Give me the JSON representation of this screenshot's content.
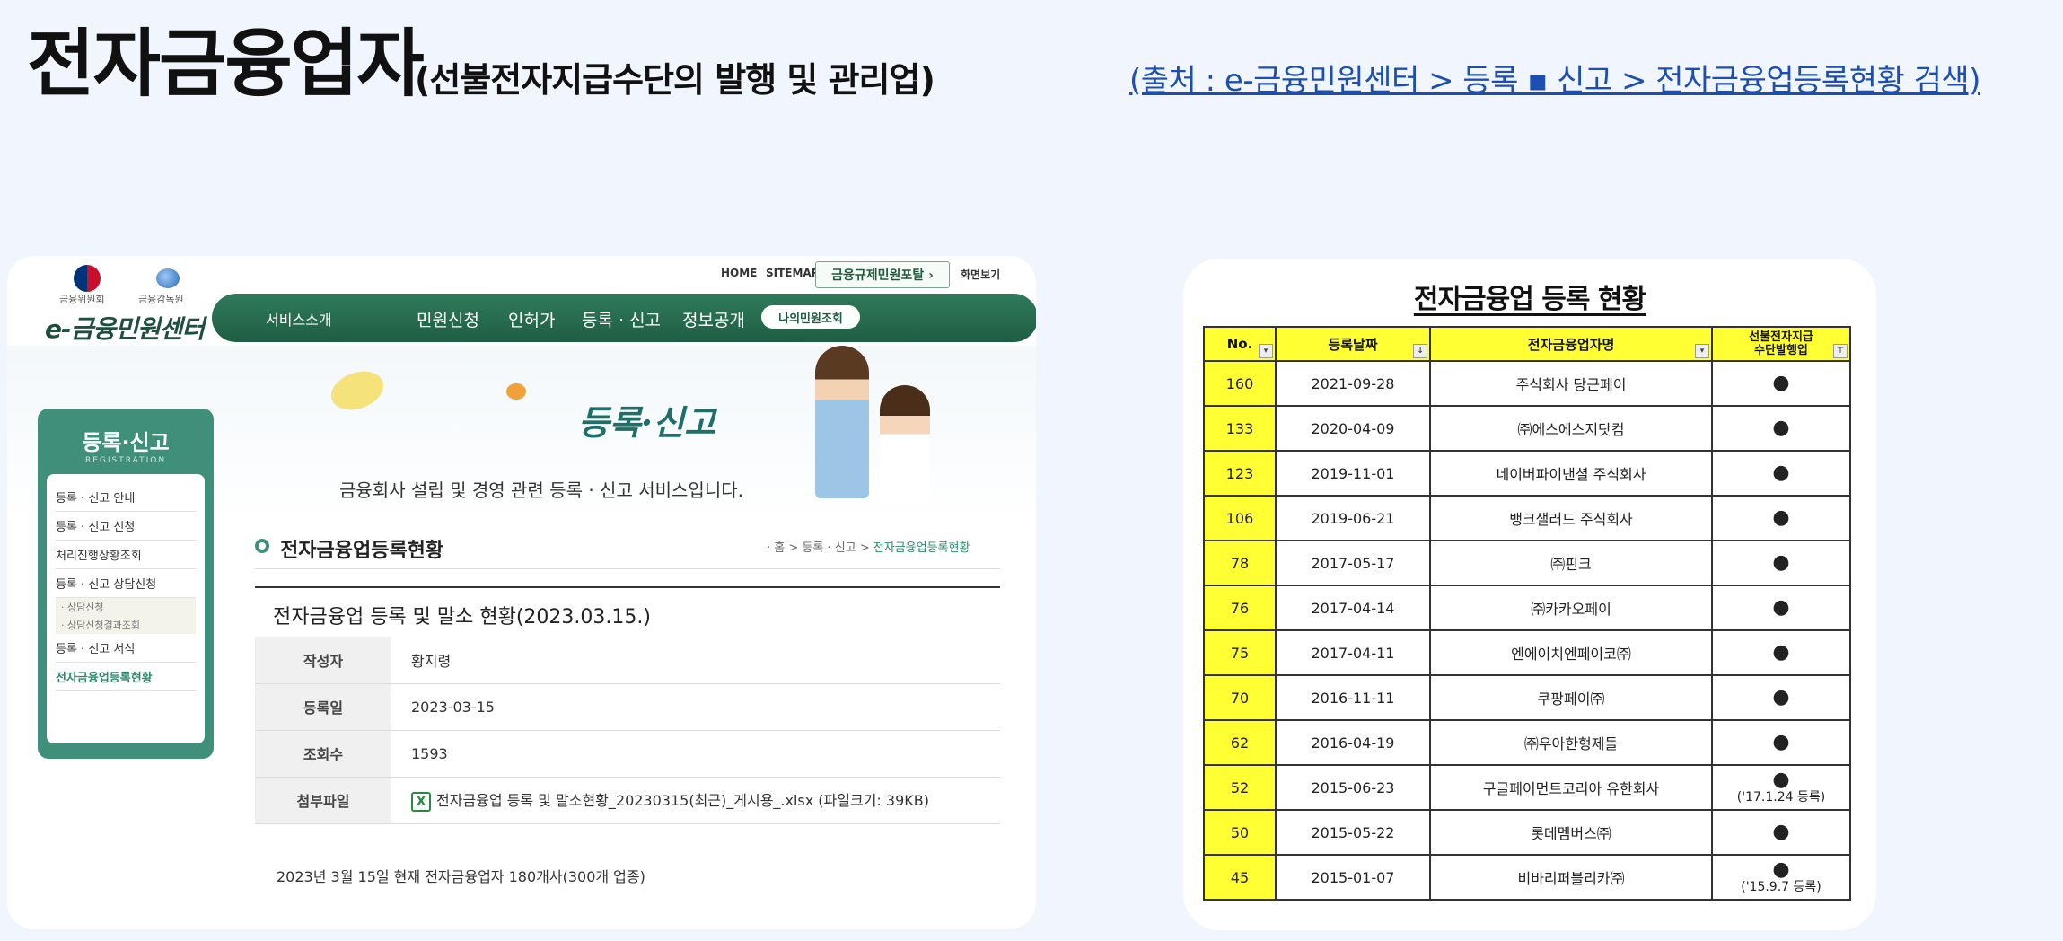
{
  "header": {
    "title_main": "전자금융업자",
    "title_sub": "(선불전자지급수단의 발행 및 관리업)",
    "source_link": "(출처 : e-금융민원센터 > 등록 ▪ 신고 > 전자금융업등록현황 검색)"
  },
  "left_screenshot": {
    "top_links": [
      "HOME",
      "SITEMAP"
    ],
    "portal_button": "금융규제민원포탈 ›",
    "view_label": "화면보기",
    "org_1": "금융위원회",
    "org_2": "금융감독원",
    "site_name": "e-금융민원센터",
    "nav": {
      "service_intro": "서비스소개",
      "items": [
        "민원신청",
        "인허가",
        "등록 · 신고",
        "정보공개"
      ],
      "my_button": "나의민원조회"
    },
    "banner_title": "등록·신고",
    "banner_desc": "금융회사 설립 및 경영 관련 등록 · 신고 서비스입니다.",
    "side_menu": {
      "title": "등록·신고",
      "subtitle": "REGISTRATION",
      "items": [
        "등록 · 신고 안내",
        "등록 · 신고 신청",
        "처리진행상황조회",
        "등록 · 신고 상담신청"
      ],
      "sub_items": [
        "· 상담신청",
        "· 상담신청결과조회"
      ],
      "items_after": [
        "등록 · 신고 서식",
        "전자금융업등록현황"
      ]
    },
    "section_title": "전자금융업등록현황",
    "breadcrumb": {
      "prefix": "· 홈 > 등록 · 신고 > ",
      "current": "전자금융업등록현황"
    },
    "post_title": "전자금융업 등록 및 말소 현황(2023.03.15.)",
    "post_rows": [
      {
        "key": "작성자",
        "value": "황지령"
      },
      {
        "key": "등록일",
        "value": "2023-03-15"
      },
      {
        "key": "조회수",
        "value": "1593"
      },
      {
        "key": "첨부파일",
        "value": "전자금융업 등록 및 말소현황_20230315(최근)_게시용_.xlsx (파일크기: 39KB)"
      }
    ],
    "xls_icon": "X",
    "footer_note": "2023년 3월 15일 현재 전자금융업자 180개사(300개 업종)"
  },
  "right_table": {
    "title": "전자금융업 등록 현황",
    "headers": [
      "No.",
      "등록날짜",
      "전자금융업자명",
      "선불전자지급\n수단발행업"
    ],
    "rows": [
      {
        "no": "160",
        "date": "2021-09-28",
        "name": "주식회사 당근페이",
        "mark": "●",
        "note": ""
      },
      {
        "no": "133",
        "date": "2020-04-09",
        "name": "㈜에스에스지닷컴",
        "mark": "●",
        "note": ""
      },
      {
        "no": "123",
        "date": "2019-11-01",
        "name": "네이버파이낸셜 주식회사",
        "mark": "●",
        "note": ""
      },
      {
        "no": "106",
        "date": "2019-06-21",
        "name": "뱅크샐러드 주식회사",
        "mark": "●",
        "note": ""
      },
      {
        "no": "78",
        "date": "2017-05-17",
        "name": "㈜핀크",
        "mark": "●",
        "note": ""
      },
      {
        "no": "76",
        "date": "2017-04-14",
        "name": "㈜카카오페이",
        "mark": "●",
        "note": ""
      },
      {
        "no": "75",
        "date": "2017-04-11",
        "name": "엔에이치엔페이코㈜",
        "mark": "●",
        "note": ""
      },
      {
        "no": "70",
        "date": "2016-11-11",
        "name": "쿠팡페이㈜",
        "mark": "●",
        "note": ""
      },
      {
        "no": "62",
        "date": "2016-04-19",
        "name": "㈜우아한형제들",
        "mark": "●",
        "note": ""
      },
      {
        "no": "52",
        "date": "2015-06-23",
        "name": "구글페이먼트코리아 유한회사",
        "mark": "●",
        "note": "('17.1.24 등록)"
      },
      {
        "no": "50",
        "date": "2015-05-22",
        "name": "롯데멤버스㈜",
        "mark": "●",
        "note": ""
      },
      {
        "no": "45",
        "date": "2015-01-07",
        "name": "비바리퍼블리카㈜",
        "mark": "●",
        "note": "('15.9.7 등록)"
      }
    ]
  }
}
